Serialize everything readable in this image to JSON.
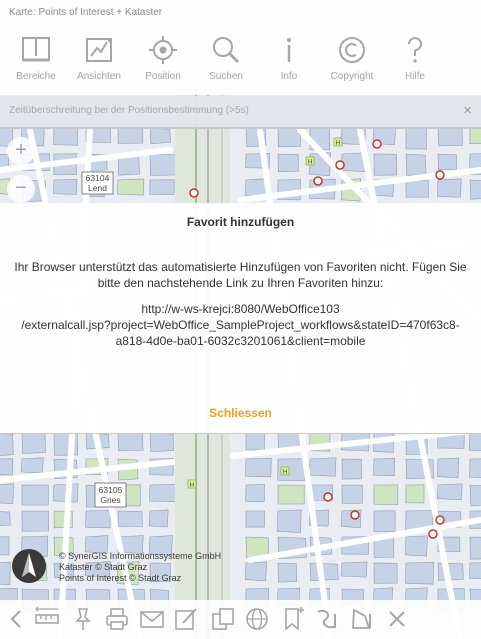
{
  "app": {
    "title": "Karte: Points of Interest + Kataster"
  },
  "toolbar": {
    "tools": [
      {
        "label": "Bereiche",
        "icon": "book-icon"
      },
      {
        "label": "Ansichten",
        "icon": "layers-icon"
      },
      {
        "label": "Position",
        "icon": "crosshair-icon"
      },
      {
        "label": "Suchen",
        "icon": "search-icon"
      },
      {
        "label": "Info",
        "icon": "info-icon"
      },
      {
        "label": "Copyright",
        "icon": "copyright-icon"
      },
      {
        "label": "Hilfe",
        "icon": "help-icon"
      }
    ]
  },
  "notice": {
    "text": "Zeitüberschreitung bei der Positionsbestimmung (>5s)",
    "close": "×"
  },
  "map": {
    "zoom_in": "+",
    "zoom_out": "−",
    "parcel_labels": [
      {
        "number": "63104",
        "name": "Lend"
      },
      {
        "number": "63105",
        "name": "Gries"
      }
    ],
    "poi_label": "H"
  },
  "dialog": {
    "title": "Favorit hinzufügen",
    "message": "Ihr Browser unterstützt das automatisierte Hinzufügen von Favoriten nicht. Fügen Sie bitte den nachstehende Link zu Ihren Favoriten hinzu:",
    "link_lines": [
      "http://w-ws-krejci:8080/WebOffice103",
      "/externalcall.jsp?project=WebOffice_SampleProject_workflows&stateID=470f63c8-",
      "a818-4d0e-ba01-6032c3201061&client=mobile"
    ],
    "close_label": "Schliessen"
  },
  "attribution": [
    "© SynerGIS Informationssysteme GmbH",
    "Kataster © Stadt Graz",
    "Points of Interest © Stadt Graz"
  ],
  "bottombar": {
    "icons": [
      "back-arrow-icon",
      "measure-icon",
      "pin-icon",
      "print-icon",
      "mail-icon",
      "edit-icon",
      "copy-icon",
      "globe-icon",
      "bookmark-add-icon",
      "draw-line-icon",
      "draw-polygon-icon",
      "close-icon"
    ],
    "close_glyph": "×"
  },
  "colors": {
    "accent": "#e8a11c",
    "map_block": "#c6d3e6",
    "map_road": "#ffffff",
    "map_green": "#cfe5c0"
  }
}
